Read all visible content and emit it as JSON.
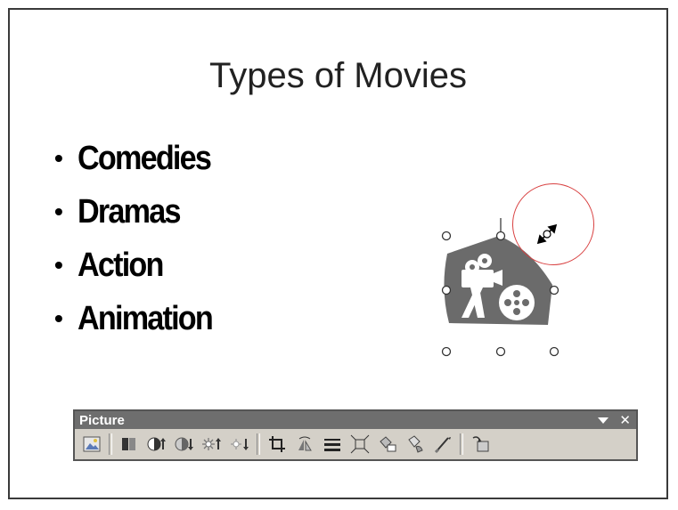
{
  "slide": {
    "title": "Types of Movies",
    "bullet_char": "•",
    "bullets": [
      "Comedies",
      "Dramas",
      "Action",
      "Animation"
    ]
  },
  "clipart": {
    "icon": "movie-camera-film-reel-clipart",
    "color": "#6b6b6b"
  },
  "cursor": {
    "icon": "diagonal-resize-cursor",
    "highlight_color": "#d84040"
  },
  "toolbar": {
    "title": "Picture",
    "menu_icon": "toolbar-options-arrow",
    "close_label": "✕",
    "buttons": [
      "insert-picture-icon",
      "color-icon",
      "more-contrast-icon",
      "less-contrast-icon",
      "more-brightness-icon",
      "less-brightness-icon",
      "crop-icon",
      "rotate-left-icon",
      "line-style-icon",
      "compress-pictures-icon",
      "format-picture-icon",
      "set-transparent-color-icon",
      "recolor-picture-icon",
      "reset-picture-icon"
    ]
  }
}
